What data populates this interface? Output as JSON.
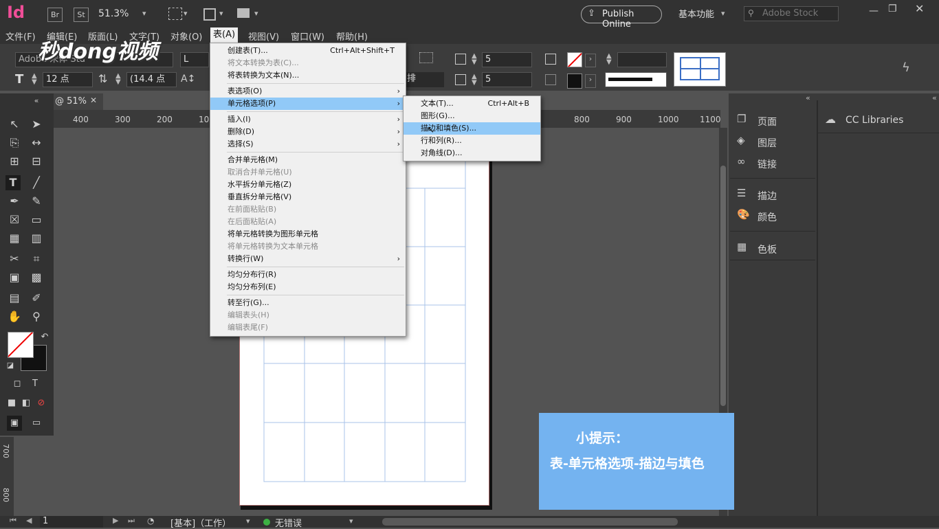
{
  "app": {
    "logo": "Id",
    "bridge_label": "Br",
    "stock_label": "St",
    "zoom": "51.3%",
    "publish_label": "Publish Online",
    "workspace": "基本功能",
    "search_placeholder": "Adobe Stock"
  },
  "watermark": "秒dong视频",
  "menubar": {
    "items": [
      "文件(F)",
      "编辑(E)",
      "版面(L)",
      "文字(T)",
      "对象(O)",
      "表(A)",
      "视图(V)",
      "窗口(W)",
      "帮助(H)"
    ]
  },
  "control": {
    "font_name": "Adobe 宋体 Std",
    "font_style": "L",
    "font_size": "12 点",
    "leading": "(14.4 点",
    "rows": "5",
    "cols": "5",
    "layout_label": "排"
  },
  "doc_tab": {
    "label": "@ 51%"
  },
  "ruler": {
    "h_ticks": [
      "400",
      "300",
      "200",
      "100",
      "800",
      "900",
      "1000",
      "1100"
    ],
    "v_ticks": [
      "700",
      "800"
    ]
  },
  "table_menu": {
    "items": [
      {
        "label": "创建表(T)...",
        "shortcut": "Ctrl+Alt+Shift+T",
        "disabled": false
      },
      {
        "label": "将文本转换为表(C)...",
        "shortcut": "",
        "disabled": true
      },
      {
        "label": "将表转换为文本(N)...",
        "shortcut": "",
        "disabled": false
      },
      {
        "label": "表选项(O)",
        "shortcut": "",
        "disabled": false,
        "submenu": true
      },
      {
        "label": "单元格选项(P)",
        "shortcut": "",
        "disabled": false,
        "submenu": true,
        "highlight": true
      },
      {
        "label": "插入(I)",
        "shortcut": "",
        "disabled": false,
        "submenu": true
      },
      {
        "label": "删除(D)",
        "shortcut": "",
        "disabled": false,
        "submenu": true
      },
      {
        "label": "选择(S)",
        "shortcut": "",
        "disabled": false,
        "submenu": true
      },
      {
        "label": "合并单元格(M)",
        "shortcut": "",
        "disabled": false
      },
      {
        "label": "取消合并单元格(U)",
        "shortcut": "",
        "disabled": true
      },
      {
        "label": "水平拆分单元格(Z)",
        "shortcut": "",
        "disabled": false
      },
      {
        "label": "垂直拆分单元格(V)",
        "shortcut": "",
        "disabled": false
      },
      {
        "label": "在前面粘贴(B)",
        "shortcut": "",
        "disabled": true
      },
      {
        "label": "在后面粘贴(A)",
        "shortcut": "",
        "disabled": true
      },
      {
        "label": "将单元格转换为图形单元格",
        "shortcut": "",
        "disabled": false
      },
      {
        "label": "将单元格转换为文本单元格",
        "shortcut": "",
        "disabled": true
      },
      {
        "label": "转换行(W)",
        "shortcut": "",
        "disabled": false,
        "submenu": true
      },
      {
        "label": "均匀分布行(R)",
        "shortcut": "",
        "disabled": false
      },
      {
        "label": "均匀分布列(E)",
        "shortcut": "",
        "disabled": false
      },
      {
        "label": "转至行(G)...",
        "shortcut": "",
        "disabled": false
      },
      {
        "label": "编辑表头(H)",
        "shortcut": "",
        "disabled": true
      },
      {
        "label": "编辑表尾(F)",
        "shortcut": "",
        "disabled": true
      }
    ]
  },
  "cell_submenu": {
    "items": [
      {
        "label": "文本(T)...",
        "shortcut": "Ctrl+Alt+B"
      },
      {
        "label": "图形(G)...",
        "shortcut": ""
      },
      {
        "label": "描边和填色(S)...",
        "shortcut": "",
        "highlight": true
      },
      {
        "label": "行和列(R)...",
        "shortcut": ""
      },
      {
        "label": "对角线(D)...",
        "shortcut": ""
      }
    ]
  },
  "right_panel": {
    "items": [
      "页面",
      "图层",
      "链接",
      "描边",
      "颜色",
      "色板"
    ],
    "libraries": "CC Libraries"
  },
  "status": {
    "page": "1",
    "master": "[基本]（工作）",
    "errors": "无错误"
  },
  "tip": {
    "title": "小提示：",
    "body": "表-单元格选项-描边与填色"
  }
}
